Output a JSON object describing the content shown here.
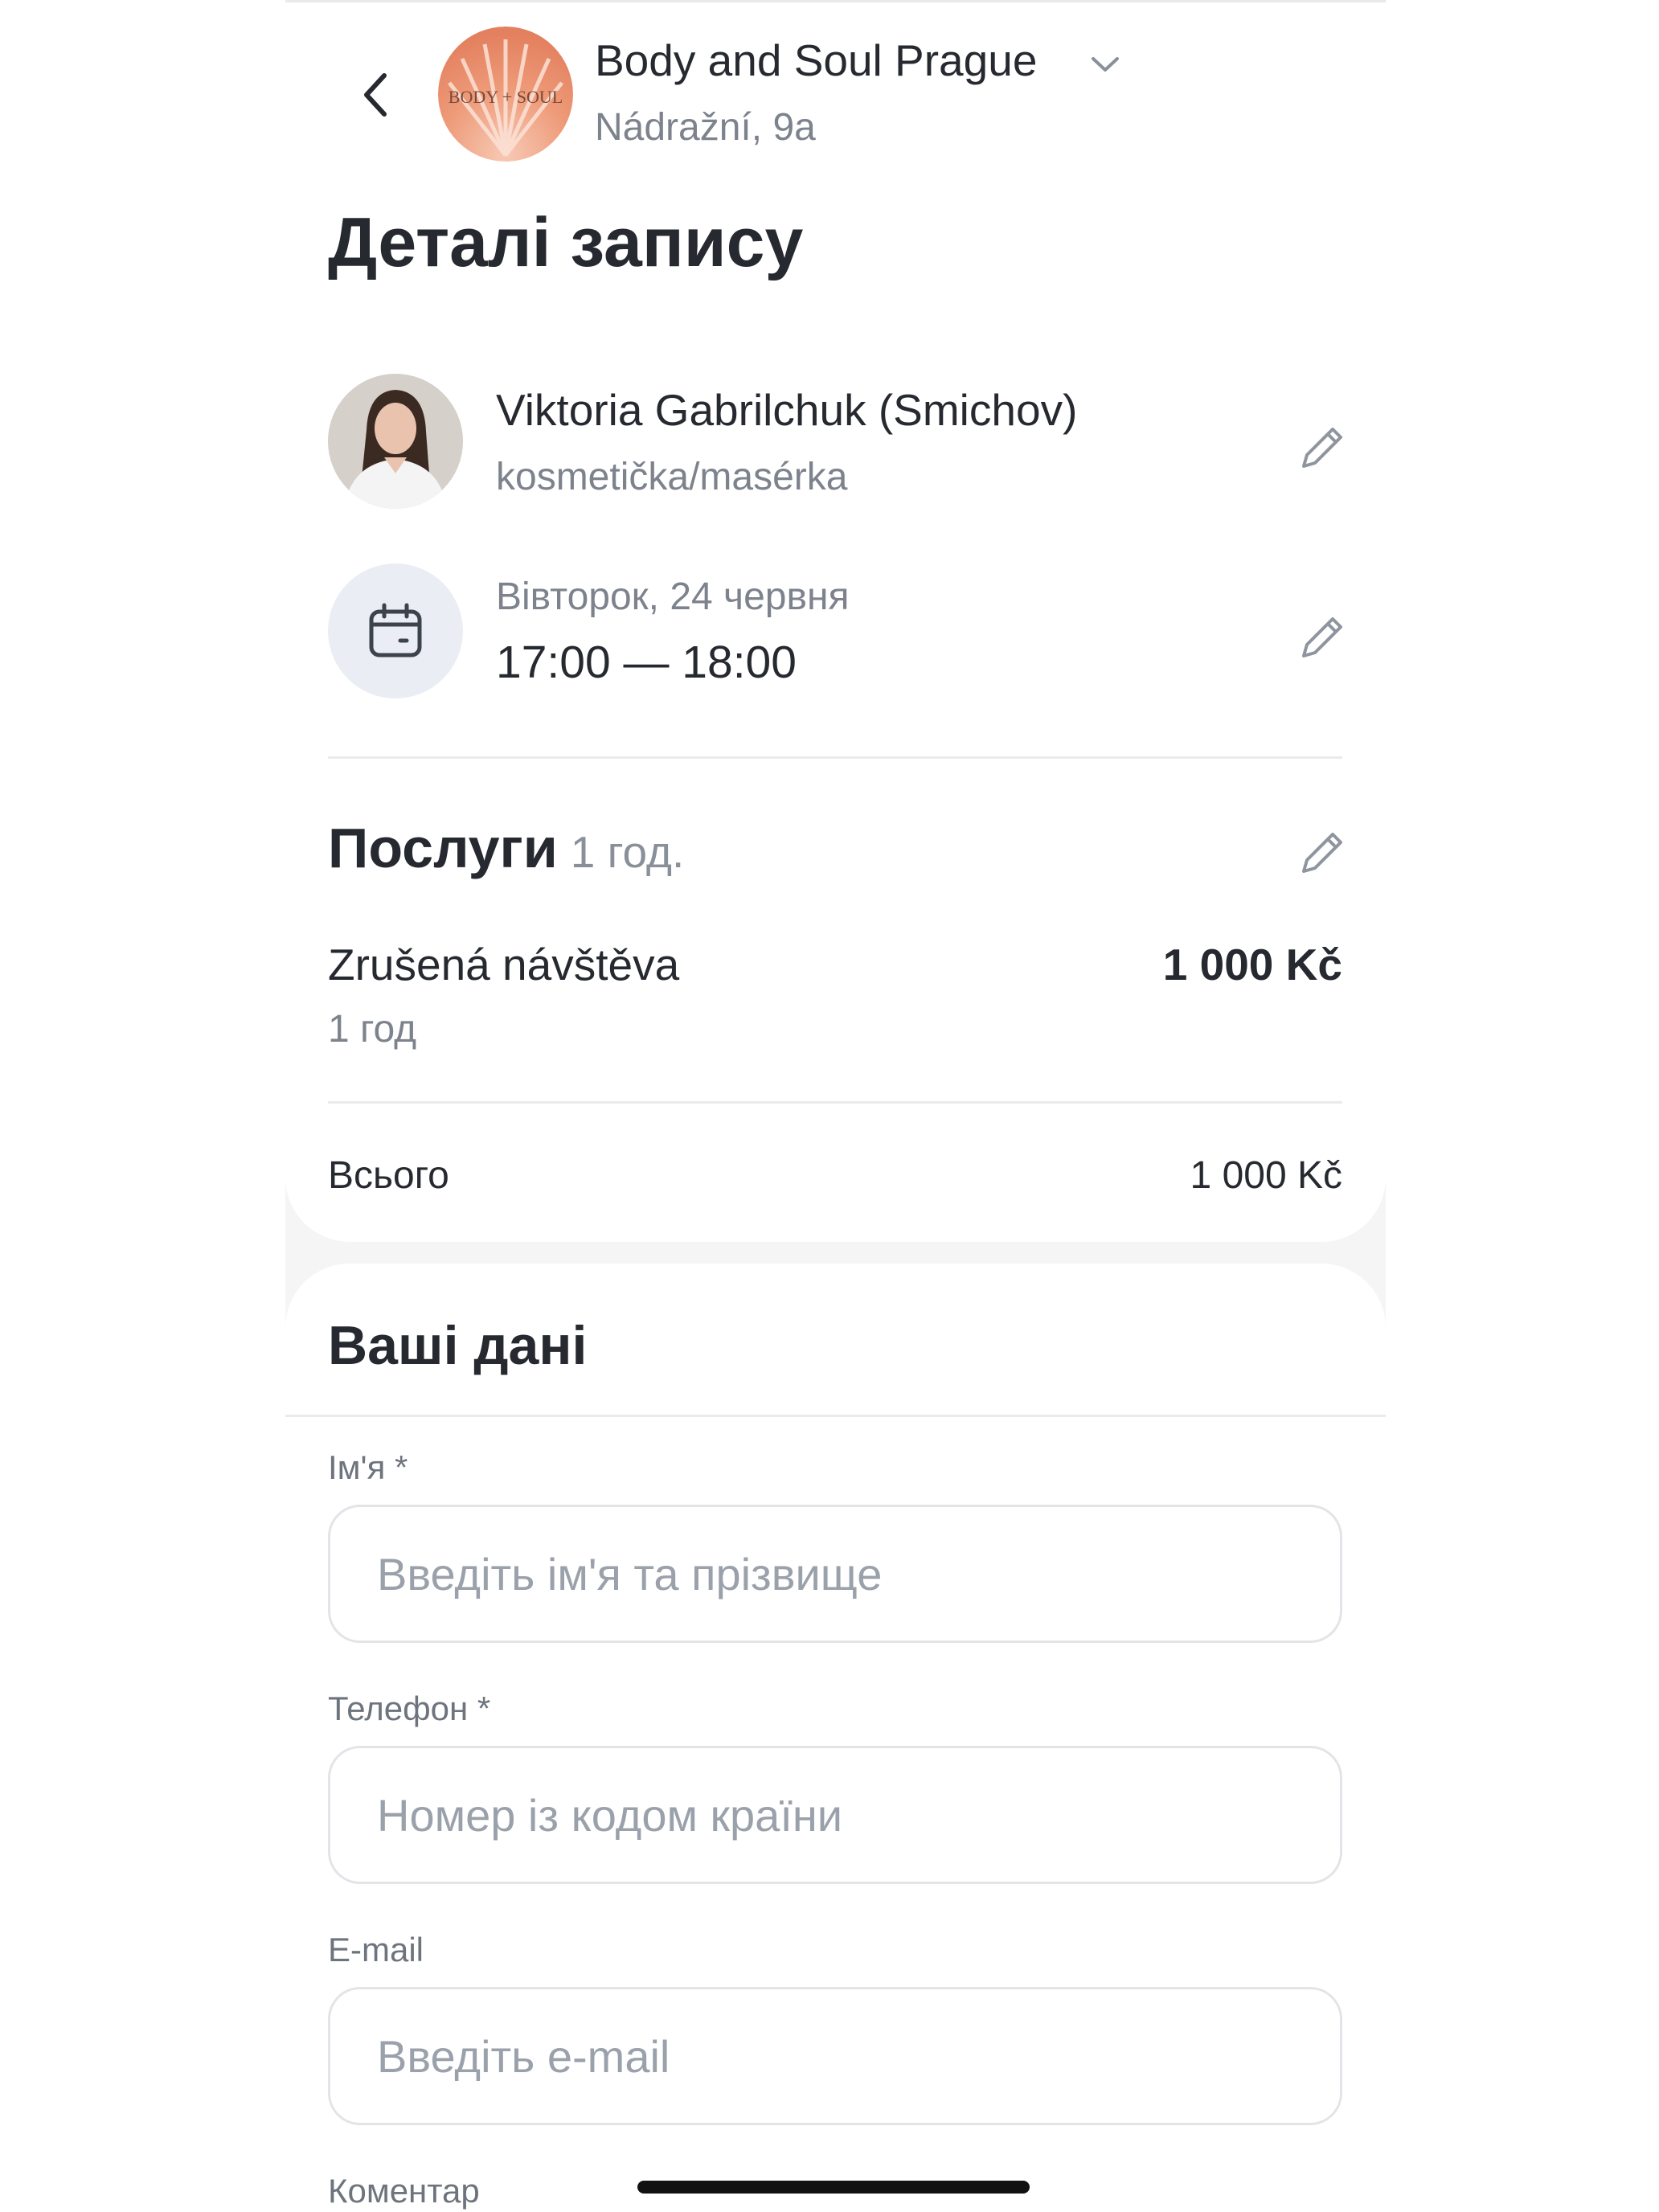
{
  "header": {
    "salon_name": "Body and Soul Prague",
    "salon_address": "Nádražní, 9a",
    "logo_text": "BODY + SOUL"
  },
  "page_title": "Деталі запису",
  "master": {
    "name": "Viktoria Gabrilchuk (Smichov)",
    "role": "kosmetička/masérka"
  },
  "appointment": {
    "date": "Вівторок, 24 червня",
    "time": "17:00 — 18:00"
  },
  "services": {
    "title": "Послуги",
    "duration_total": "1 год.",
    "items": [
      {
        "name": "Zrušená návštěva",
        "duration": "1 год",
        "price": "1 000 Kč"
      }
    ],
    "total_label": "Всього",
    "total_value": "1 000 Kč"
  },
  "form": {
    "title": "Ваші дані",
    "name_label": "Ім'я *",
    "name_placeholder": "Введіть ім'я та прізвище",
    "phone_label": "Телефон *",
    "phone_placeholder": "Номер із кодом країни",
    "email_label": "E-mail",
    "email_placeholder": "Введіть e-mail",
    "comment_label": "Коментар"
  },
  "colors": {
    "text_primary": "#262a30",
    "text_secondary": "#7d838d",
    "icon_circle_bg": "#eaeef4",
    "logo_accent": "#e8906e"
  }
}
